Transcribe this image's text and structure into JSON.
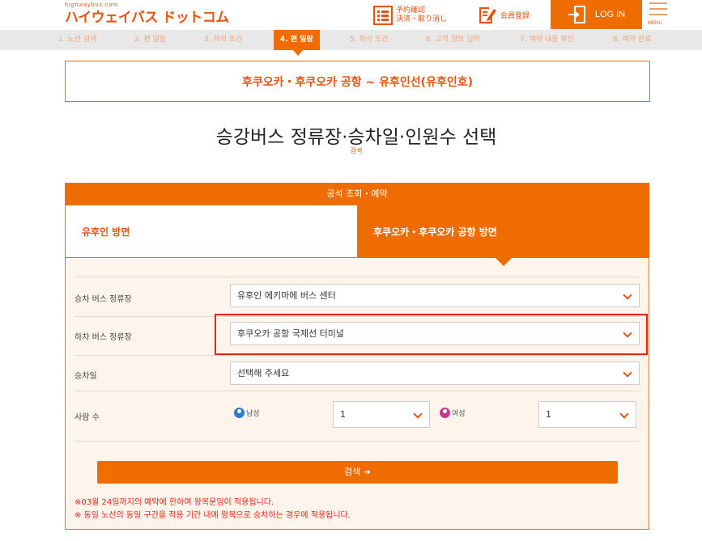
{
  "header": {
    "logo_small": "highwaybus.com",
    "logo_main": "ハイウェイバス ドットコム",
    "reserve_line1": "予約確認",
    "reserve_line2": "決済・取り消し",
    "member": "会員登録",
    "login": "LOG IN",
    "menu": "MENU"
  },
  "steps": [
    {
      "label": "1. 노선 검색"
    },
    {
      "label": "2. 편 일람"
    },
    {
      "label": "3. 좌석 조건"
    },
    {
      "label": "4. 편 일람"
    },
    {
      "label": "5. 좌석 조건"
    },
    {
      "label": "6. 고객 정보 입력"
    },
    {
      "label": "7. 예약 내용 확인"
    },
    {
      "label": "8. 예약 완료"
    }
  ],
  "route_title": "후쿠오카・후쿠오카 공항 ~ 유후인선(유후인호)",
  "page_title": "승강버스 정류장·승차일·인원수 선택",
  "page_subtitle": "검색",
  "panel": {
    "head": "공석 조회・예약",
    "tab_left": "유후인 방면",
    "tab_right": "후쿠오카・후쿠오카 공항 방면"
  },
  "form": {
    "board_label": "승차 버스 정류장",
    "board_value": "유후인 에키마에 버스 센터",
    "alight_label": "하차 버스 정류장",
    "alight_value": "후쿠오카 공항 국제선 터미널",
    "date_label": "승차일",
    "date_value": "선택해 주세요",
    "people_label": "사람 수",
    "male_label": "남성",
    "male_value": "1",
    "female_label": "여성",
    "female_value": "1"
  },
  "search_button": "검색 ➔",
  "notes": [
    "※03월 24일까지의 예약에 한하여 왕복운임이 적용됩니다.",
    "※ 동일 노선의 동일 구간을 적용 기간 내에 왕복으로 승차하는 경우에 적용됩니다."
  ],
  "colors": {
    "accent": "#ef6c00",
    "highlight": "#ee2211"
  }
}
